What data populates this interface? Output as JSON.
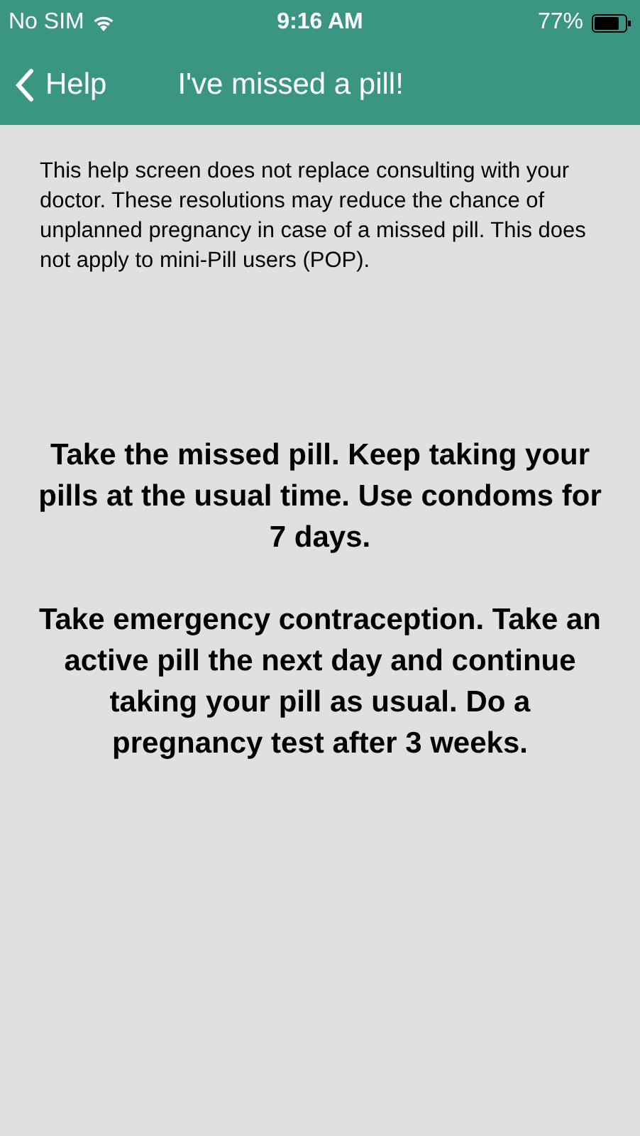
{
  "status_bar": {
    "carrier": "No SIM",
    "time": "9:16 AM",
    "battery": "77%"
  },
  "nav_bar": {
    "back_label": "Help",
    "title": "I've missed a pill!"
  },
  "intro": "This help screen does not replace consulting with your doctor. These resolutions may reduce the chance of unplanned pregnancy in case of a missed pill. This does not apply to mini-Pill users (POP).",
  "instructions": [
    "Take the missed pill. Keep taking your pills at the usual time. Use condoms for 7 days.",
    "Take emergency contraception. Take an active pill the next day and continue taking your pill as usual. Do a pregnancy test after 3 weeks."
  ]
}
